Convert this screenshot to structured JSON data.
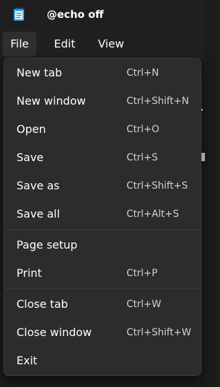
{
  "window": {
    "tab_title": "@echo off",
    "app_icon": "notepad-icon"
  },
  "menubar": {
    "items": [
      "File",
      "Edit",
      "View"
    ],
    "active": "File"
  },
  "file_menu": {
    "groups": [
      [
        {
          "label": "New tab",
          "shortcut": "Ctrl+N"
        },
        {
          "label": "New window",
          "shortcut": "Ctrl+Shift+N"
        },
        {
          "label": "Open",
          "shortcut": "Ctrl+O"
        },
        {
          "label": "Save",
          "shortcut": "Ctrl+S"
        },
        {
          "label": "Save as",
          "shortcut": "Ctrl+Shift+S"
        },
        {
          "label": "Save all",
          "shortcut": "Ctrl+Alt+S"
        }
      ],
      [
        {
          "label": "Page setup",
          "shortcut": ""
        },
        {
          "label": "Print",
          "shortcut": "Ctrl+P"
        }
      ],
      [
        {
          "label": "Close tab",
          "shortcut": "Ctrl+W"
        },
        {
          "label": "Close window",
          "shortcut": "Ctrl+Shift+W"
        },
        {
          "label": "Exit",
          "shortcut": ""
        }
      ]
    ]
  },
  "colors": {
    "menu_background": "#2c2c2c",
    "separator": "#3d3d3d",
    "text": "#ffffff",
    "shortcut_text": "#d2d2d2"
  }
}
